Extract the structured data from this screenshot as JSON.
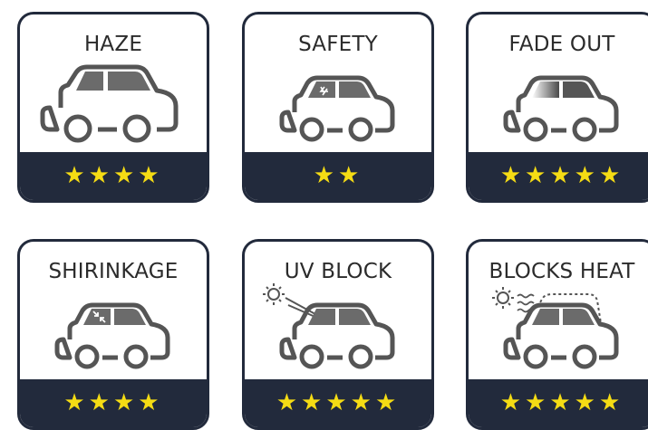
{
  "cards": [
    {
      "title": "HAZE",
      "stars": "★★★★",
      "rating": 4
    },
    {
      "title": "SAFETY",
      "stars": "★★",
      "rating": 2
    },
    {
      "title": "FADE OUT",
      "stars": "★★★★★",
      "rating": 5
    },
    {
      "title": "SHIRINKAGE",
      "stars": "★★★★",
      "rating": 4
    },
    {
      "title": "UV BLOCK",
      "stars": "★★★★★",
      "rating": 5
    },
    {
      "title": "BLOCKS HEAT",
      "stars": "★★★★★",
      "rating": 5
    }
  ],
  "colors": {
    "band": "#222a3c",
    "star": "#f5dc14",
    "car_outline": "#555555",
    "window": "#6b6b6b"
  }
}
